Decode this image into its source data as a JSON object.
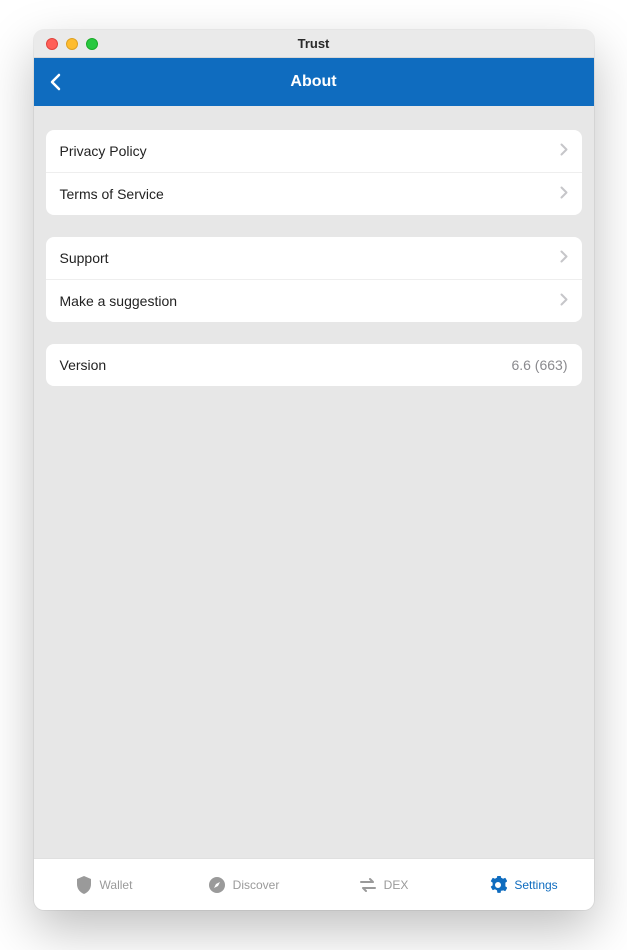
{
  "window": {
    "title": "Trust"
  },
  "header": {
    "title": "About"
  },
  "groups": [
    {
      "rows": [
        {
          "label": "Privacy Policy"
        },
        {
          "label": "Terms of Service"
        }
      ]
    },
    {
      "rows": [
        {
          "label": "Support"
        },
        {
          "label": "Make a suggestion"
        }
      ]
    }
  ],
  "version": {
    "label": "Version",
    "value": "6.6 (663)"
  },
  "tabs": {
    "wallet": "Wallet",
    "discover": "Discover",
    "dex": "DEX",
    "settings": "Settings"
  },
  "colors": {
    "accent": "#0f6cbf",
    "bg": "#e7e7e7"
  }
}
